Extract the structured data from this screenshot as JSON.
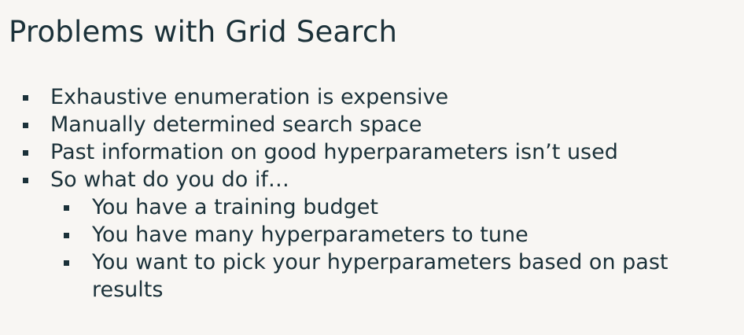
{
  "slide": {
    "title": "Problems with Grid Search",
    "bullets": [
      {
        "text": "Exhaustive enumeration is expensive"
      },
      {
        "text": "Manually determined search space"
      },
      {
        "text": "Past information on good hyperparameters isn’t used"
      },
      {
        "text": "So what do you do if…"
      }
    ],
    "sub_bullets": [
      {
        "text": "You have a training budget"
      },
      {
        "text": "You have many hyperparameters to tune"
      },
      {
        "text": "You want to pick your hyperparameters based on past",
        "text_cont": "results"
      }
    ]
  }
}
